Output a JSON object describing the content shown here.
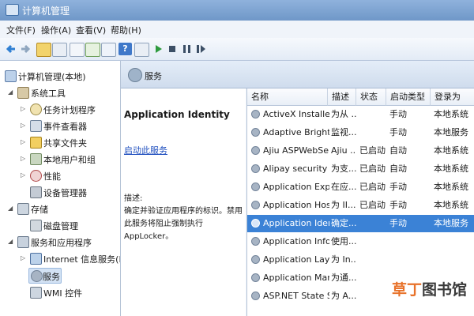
{
  "window": {
    "title": "计算机管理"
  },
  "menu": [
    "文件(F)",
    "操作(A)",
    "查看(V)",
    "帮助(H)"
  ],
  "tree": [
    {
      "label": "计算机管理(本地)",
      "icon": "computer-icon"
    },
    {
      "label": "系统工具",
      "icon": "tools-icon"
    },
    {
      "label": "任务计划程序",
      "icon": "clock-icon"
    },
    {
      "label": "事件查看器",
      "icon": "event-viewer-icon"
    },
    {
      "label": "共享文件夹",
      "icon": "shared-folder-icon"
    },
    {
      "label": "本地用户和组",
      "icon": "users-icon"
    },
    {
      "label": "性能",
      "icon": "performance-icon"
    },
    {
      "label": "设备管理器",
      "icon": "device-manager-icon"
    },
    {
      "label": "存储",
      "icon": "storage-icon"
    },
    {
      "label": "磁盘管理",
      "icon": "disk-icon"
    },
    {
      "label": "服务和应用程序",
      "icon": "services-apps-icon"
    },
    {
      "label": "Internet 信息服务(IIS",
      "icon": "iis-icon"
    },
    {
      "label": "服务",
      "icon": "services-icon"
    },
    {
      "label": "WMI 控件",
      "icon": "wmi-icon"
    }
  ],
  "header": {
    "title": "服务"
  },
  "detail": {
    "name": "Application Identity",
    "link_start": "启动",
    "link_rest": "此服务",
    "desc_label": "描述:",
    "desc_text": "确定并验证应用程序的标识。禁用此服务将阻止强制执行 AppLocker。"
  },
  "columns": [
    "名称",
    "描述",
    "状态",
    "启动类型",
    "登录为"
  ],
  "services": [
    {
      "name": "ActiveX Installer ...",
      "desc": "为从 ...",
      "status": "",
      "startup": "手动",
      "logon": "本地系统"
    },
    {
      "name": "Adaptive Brightn...",
      "desc": "监视...",
      "status": "",
      "startup": "手动",
      "logon": "本地服务"
    },
    {
      "name": "Ajiu ASPWebSer...",
      "desc": "Ajiu ...",
      "status": "已启动",
      "startup": "自动",
      "logon": "本地系统"
    },
    {
      "name": "Alipay security s...",
      "desc": "为支...",
      "status": "已启动",
      "startup": "自动",
      "logon": "本地系统"
    },
    {
      "name": "Application Expe...",
      "desc": "在应...",
      "status": "已启动",
      "startup": "手动",
      "logon": "本地系统"
    },
    {
      "name": "Application Host...",
      "desc": "为 II...",
      "status": "已启动",
      "startup": "手动",
      "logon": "本地系统"
    },
    {
      "name": "Application Iden...",
      "desc": "确定...",
      "status": "",
      "startup": "手动",
      "logon": "本地服务"
    },
    {
      "name": "Application Infor...",
      "desc": "使用...",
      "status": "",
      "startup": "",
      "logon": ""
    },
    {
      "name": "Application Laye...",
      "desc": "为 In...",
      "status": "",
      "startup": "",
      "logon": ""
    },
    {
      "name": "Application Man...",
      "desc": "为通...",
      "status": "",
      "startup": "",
      "logon": ""
    },
    {
      "name": "ASP.NET State Se...",
      "desc": "为 A...",
      "status": "",
      "startup": "",
      "logon": ""
    }
  ],
  "watermark": {
    "part1": "草丁",
    "part2": "图书馆"
  },
  "colors": {
    "selection": "#3b82d6",
    "link": "#1f4fbf",
    "watermark": "#e8722a"
  }
}
